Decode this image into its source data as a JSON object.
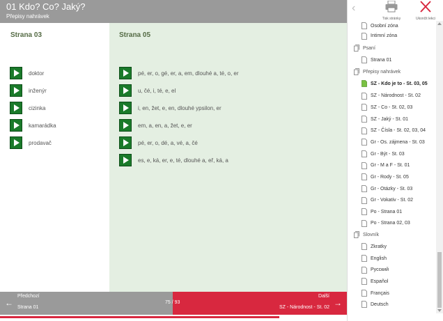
{
  "header": {
    "title": "01 Kdo? Co? Jaký?",
    "subtitle": "Přepisy nahrávek"
  },
  "columns": {
    "left": {
      "heading": "Strana 03",
      "items": [
        "doktor",
        "inženýr",
        "cizinka",
        "kamarádka",
        "prodavač"
      ]
    },
    "right": {
      "heading": "Strana 05",
      "items": [
        "pé, er, o, gé, er, a, em, dlouhé a, té, o, er",
        "u, čé, i, té, e, el",
        "i, en, žet, e, en, dlouhé ypsilon, er",
        "em, a, en, a, žet, e, er",
        "pé, er, o, dé, a, vé, a, čé",
        "es, e, ká, er, e, té, dlouhé a, eř, ká, a"
      ]
    }
  },
  "footer": {
    "prev_label": "Předchozí",
    "prev_target": "Strana 01",
    "next_label": "Další",
    "next_target": "SZ - Národnost - St. 02",
    "page_count": "75 / 93",
    "progress": 0.806
  },
  "toolbar": {
    "print_label": "Tisk stránky",
    "exit_label": "Ukončit lekci"
  },
  "tree": {
    "items": [
      {
        "label": "Osobní zóna",
        "kind": "page"
      },
      {
        "label": "Intimní zóna",
        "kind": "page"
      },
      {
        "label": "Psaní",
        "kind": "group"
      },
      {
        "label": "Strana 01",
        "kind": "page"
      },
      {
        "label": "Přepisy nahrávek",
        "kind": "group"
      },
      {
        "label": "SZ - Kdo je to - St. 03, 05",
        "kind": "page",
        "active": true
      },
      {
        "label": "SZ - Národnost - St. 02",
        "kind": "page"
      },
      {
        "label": "SZ - Co - St. 02, 03",
        "kind": "page"
      },
      {
        "label": "SZ - Jaký - St. 01",
        "kind": "page"
      },
      {
        "label": "SZ - Čísla - St. 02, 03, 04",
        "kind": "page"
      },
      {
        "label": "Gr - Os. zájmena - St. 03",
        "kind": "page"
      },
      {
        "label": "Gr - Být - St. 03",
        "kind": "page"
      },
      {
        "label": "Gr - M a F - St. 01",
        "kind": "page"
      },
      {
        "label": "Gr - Rody - St. 05",
        "kind": "page"
      },
      {
        "label": "Gr - Otázky - St. 03",
        "kind": "page"
      },
      {
        "label": "Gr - Vokativ - St. 02",
        "kind": "page"
      },
      {
        "label": "Po - Strana 01",
        "kind": "page"
      },
      {
        "label": "Po - Strana 02, 03",
        "kind": "page"
      },
      {
        "label": "Slovník",
        "kind": "group"
      },
      {
        "label": "Zkratky",
        "kind": "page"
      },
      {
        "label": "English",
        "kind": "page"
      },
      {
        "label": "Русский",
        "kind": "page"
      },
      {
        "label": "Español",
        "kind": "page"
      },
      {
        "label": "Français",
        "kind": "page"
      },
      {
        "label": "Deutsch",
        "kind": "page"
      }
    ]
  },
  "colors": {
    "header_gray": "#9a9a9a",
    "accent_red": "#d8283f",
    "play_green": "#1a7a2a",
    "panel_green": "#e4efe2",
    "active_page_green": "#7ac143"
  }
}
